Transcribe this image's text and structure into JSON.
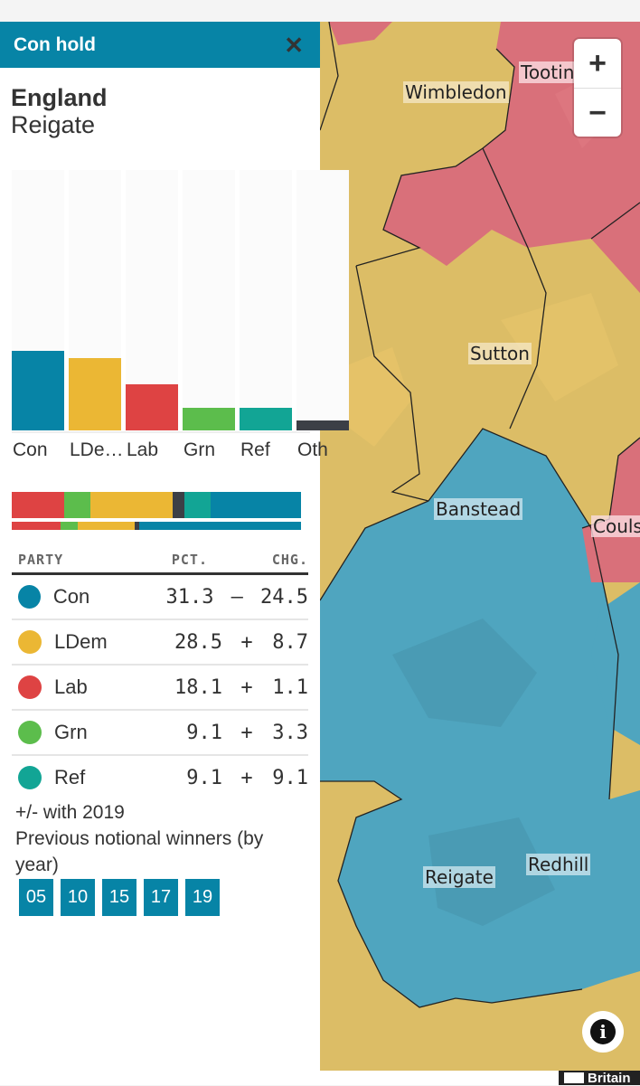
{
  "panel": {
    "result_title": "Con hold",
    "close_icon": "close-icon",
    "country": "England",
    "constituency": "Reigate",
    "note_change": "+/- with 2019",
    "note_previous": "Previous notional winners (by year)",
    "previous_years": [
      "05",
      "10",
      "15",
      "17",
      "19"
    ]
  },
  "colors": {
    "header": "#0784a6",
    "Con": "#0784a6",
    "LDem": "#ebb734",
    "Lab": "#de4343",
    "Grn": "#5cbd4c",
    "Ref": "#12a595",
    "Oth": "#3c3f46"
  },
  "chart_data": {
    "type": "bar",
    "title": "",
    "xlabel": "",
    "ylabel": "",
    "categories": [
      "Con",
      "LDe…",
      "Lab",
      "Grn",
      "Ref",
      "Oth"
    ],
    "values": [
      31.3,
      28.5,
      18.1,
      9.1,
      9.1,
      3.9
    ],
    "ylim": [
      0,
      100
    ],
    "stacked_current": [
      {
        "party": "Lab",
        "value": 18.1
      },
      {
        "party": "Grn",
        "value": 9.1
      },
      {
        "party": "LDem",
        "value": 28.5
      },
      {
        "party": "Oth",
        "value": 3.9
      },
      {
        "party": "Ref",
        "value": 9.1
      },
      {
        "party": "Con",
        "value": 31.3
      }
    ],
    "stacked_previous": [
      {
        "party": "Lab",
        "value": 17.0
      },
      {
        "party": "Grn",
        "value": 5.8
      },
      {
        "party": "LDem",
        "value": 19.8
      },
      {
        "party": "Oth",
        "value": 1.6
      },
      {
        "party": "Con",
        "value": 55.8
      }
    ]
  },
  "table": {
    "headers": {
      "party": "PARTY",
      "pct": "PCT.",
      "chg": "CHG."
    },
    "rows": [
      {
        "party": "Con",
        "pct": "31.3",
        "sign": "–",
        "chg": "24.5"
      },
      {
        "party": "LDem",
        "pct": "28.5",
        "sign": "+",
        "chg": "8.7"
      },
      {
        "party": "Lab",
        "pct": "18.1",
        "sign": "+",
        "chg": "1.1"
      },
      {
        "party": "Grn",
        "pct": "9.1",
        "sign": "+",
        "chg": "3.3"
      },
      {
        "party": "Ref",
        "pct": "9.1",
        "sign": "+",
        "chg": "9.1"
      }
    ]
  },
  "map": {
    "places": [
      "Wimbledon",
      "Tootin",
      "Sutton",
      "Banstead",
      "Couls",
      "Reigate",
      "Redhill"
    ],
    "zoom_in": "+",
    "zoom_out": "−",
    "info_label": "i",
    "logo_text": "Britain"
  }
}
